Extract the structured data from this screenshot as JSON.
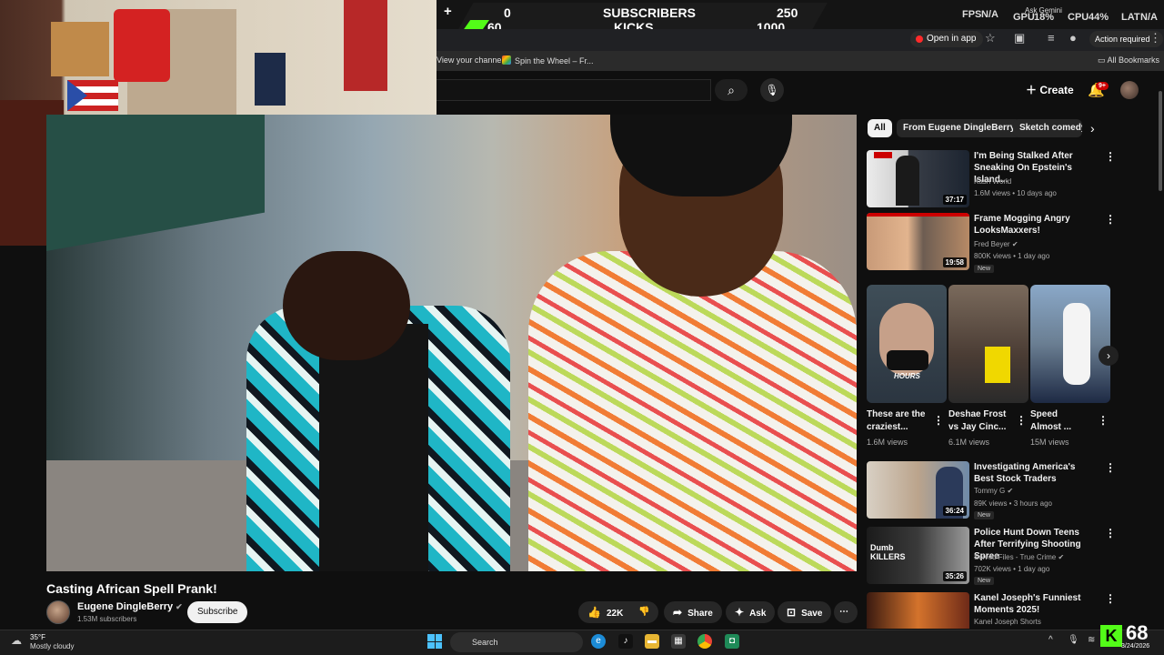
{
  "overlay": {
    "plus": "+",
    "subscribers_current": "0",
    "subscribers_label": "SUBSCRIBERS",
    "subscribers_goal": "250",
    "kicks_current": "60",
    "kicks_label": "KICKS",
    "kicks_goal": "1000",
    "fps_label": "FPS",
    "fps_value": "N/A",
    "gpu_label": "GPU",
    "gpu_value": "18%",
    "cpu_label": "CPU",
    "cpu_value": "44%",
    "lat_label": "LAT",
    "lat_value": "N/A",
    "ask_gemini": "Ask Gemini",
    "kick_color": "#53fc18"
  },
  "browser": {
    "open_in_app": "Open in app",
    "action_required": "Action required",
    "bookmarks": [
      "View your channel",
      "Spin the Wheel – Fr..."
    ],
    "all_bookmarks": "All Bookmarks"
  },
  "youtube_header": {
    "create_label": "Create",
    "notifications_badge": "9+"
  },
  "video": {
    "title": "Casting African Spell Prank!",
    "channel": "Eugene DingleBerry",
    "subscribers": "1.53M subscribers",
    "subscribe_label": "Subscribe",
    "likes": "22K",
    "share_label": "Share",
    "ask_label": "Ask",
    "save_label": "Save"
  },
  "chips": [
    "All",
    "From Eugene DingleBerry",
    "Sketch comedy"
  ],
  "recommendations_top": [
    {
      "title": "I'm Being Stalked After Sneaking On Epstein's Island...",
      "channel": "Kash World",
      "meta": "1.6M views • 10 days ago",
      "duration": "37:17",
      "new": ""
    },
    {
      "title": "Frame Mogging Angry LooksMaxxers!",
      "channel": "Fred Beyer",
      "meta": "800K views • 1 day ago",
      "duration": "19:58",
      "new": "New"
    }
  ],
  "shorts": [
    {
      "title": "These are the craziest...",
      "views": "1.6M views",
      "overlay": "HOURS"
    },
    {
      "title": "Deshae Frost vs Jay Cinc...",
      "views": "6.1M views"
    },
    {
      "title": "Speed Almost ...",
      "views": "15M views"
    }
  ],
  "recommendations_bottom": [
    {
      "title": "Investigating America's Best Stock Traders",
      "channel": "Tommy G",
      "meta": "89K views • 3 hours ago",
      "duration": "36:24",
      "new": "New"
    },
    {
      "title": "Police Hunt Down Teens After Terrifying Shooting Spree",
      "channel": "Solved Files - True Crime",
      "meta": "702K views • 1 day ago",
      "duration": "35:26",
      "new": "New",
      "thumb_text": "Dumb KILLERS"
    },
    {
      "title": "Kanel Joseph's Funniest Moments 2025!",
      "channel": "Kanel Joseph Shorts",
      "meta": "",
      "duration": "",
      "new": ""
    }
  ],
  "taskbar": {
    "temperature": "35°F",
    "weather": "Mostly cloudy",
    "search_label": "Search",
    "kick_count": "68",
    "date": "3/24/2026"
  }
}
